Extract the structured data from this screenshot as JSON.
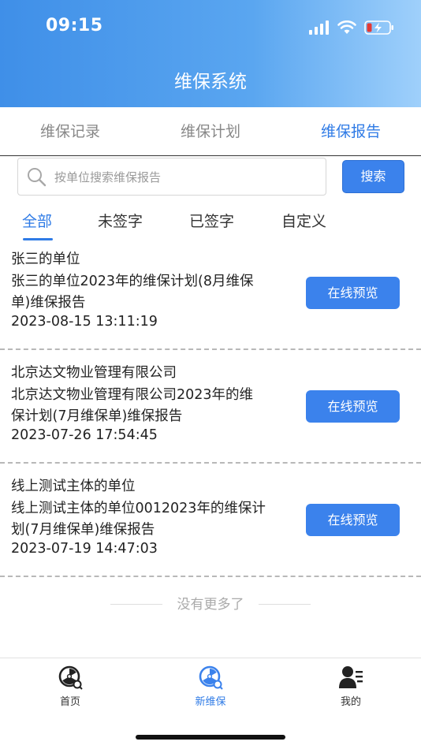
{
  "status_bar": {
    "time": "09:15"
  },
  "header": {
    "title": "维保系统"
  },
  "tabs": [
    {
      "label": "维保记录",
      "active": false
    },
    {
      "label": "维保计划",
      "active": false
    },
    {
      "label": "维保报告",
      "active": true
    }
  ],
  "search": {
    "placeholder": "按单位搜索维保报告",
    "button_label": "搜索"
  },
  "filters": [
    {
      "label": "全部",
      "active": true
    },
    {
      "label": "未签字",
      "active": false
    },
    {
      "label": "已签字",
      "active": false
    },
    {
      "label": "自定义",
      "active": false
    }
  ],
  "records": [
    {
      "unit": "张三的单位",
      "title_line1": "张三的单位2023年的维保计划(8月维保",
      "title_line2": "单)维保报告",
      "datetime": "2023-08-15 13:11:19",
      "button_label": "在线预览"
    },
    {
      "unit": "北京达文物业管理有限公司",
      "title_line1": "北京达文物业管理有限公司2023年的维",
      "title_line2": "保计划(7月维保单)维保报告",
      "datetime": "2023-07-26 17:54:45",
      "button_label": "在线预览"
    },
    {
      "unit": "线上测试主体的单位",
      "title_line1": "线上测试主体的单位0012023年的维保计",
      "title_line2": "划(7月维保单)维保报告",
      "datetime": "2023-07-19 14:47:03",
      "button_label": "在线预览"
    }
  ],
  "list_end_text": "没有更多了",
  "tabbar": [
    {
      "label": "首页",
      "icon": "home-fan-icon",
      "active": false
    },
    {
      "label": "新维保",
      "icon": "new-maintenance-icon",
      "active": true
    },
    {
      "label": "我的",
      "icon": "profile-icon",
      "active": false
    }
  ],
  "colors": {
    "accent": "#3b82ec",
    "header_start": "#3f8fe8",
    "header_end": "#9fd0fb"
  }
}
